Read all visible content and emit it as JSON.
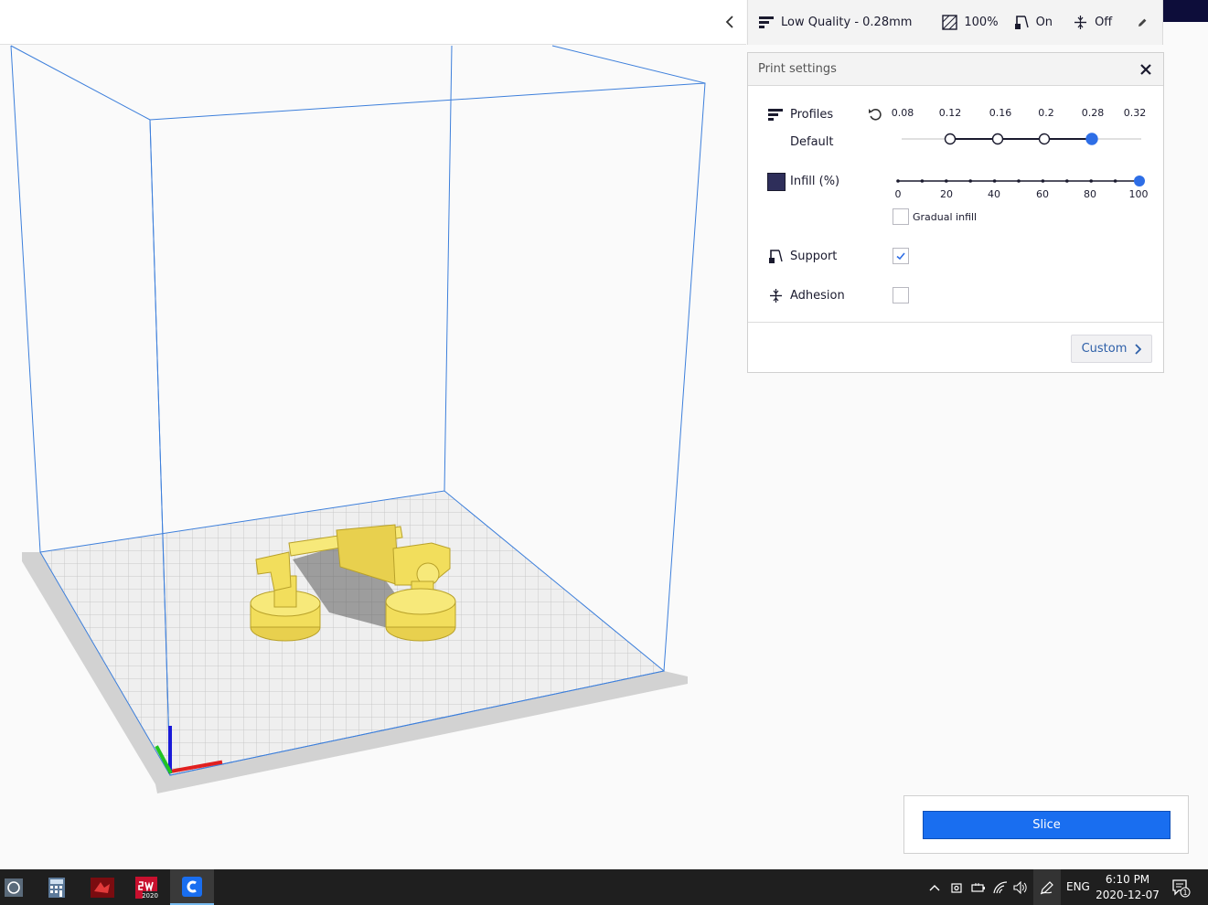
{
  "settings_bar": {
    "profile_label": "Low Quality - 0.28mm",
    "infill_value": "100%",
    "support_value": "On",
    "adhesion_value": "Off"
  },
  "panel": {
    "title": "Print settings",
    "profiles_label": "Profiles",
    "profile_name": "Default",
    "layer_height_ticks": [
      "0.08",
      "0.12",
      "0.16",
      "0.2",
      "0.28",
      "0.32"
    ],
    "selected_layer_height": "0.28",
    "infill_label": "Infill (%)",
    "infill_ticks": [
      "0",
      "20",
      "40",
      "60",
      "80",
      "100"
    ],
    "infill_percent": 100,
    "gradual_infill_label": "Gradual infill",
    "gradual_infill_checked": false,
    "support_label": "Support",
    "support_checked": true,
    "adhesion_label": "Adhesion",
    "adhesion_checked": false,
    "custom_label": "Custom"
  },
  "slice": {
    "label": "Slice"
  },
  "taskbar": {
    "apps": [
      "unknown-app-icon",
      "calculator-icon",
      "red-app-icon",
      "solidworks-2020-icon",
      "cura-icon"
    ],
    "solidworks_badge": "2020",
    "language": "ENG",
    "time": "6:10 PM",
    "date": "2020-12-07",
    "notification_count": "1"
  },
  "colors": {
    "accent": "#196ef0",
    "slider_thumb": "#2e6ee6",
    "infill_swatch": "#2e2e5a",
    "build_volume": "#3d7fdb",
    "model": "#f2de5c",
    "taskbar": "#1f1f1f"
  }
}
